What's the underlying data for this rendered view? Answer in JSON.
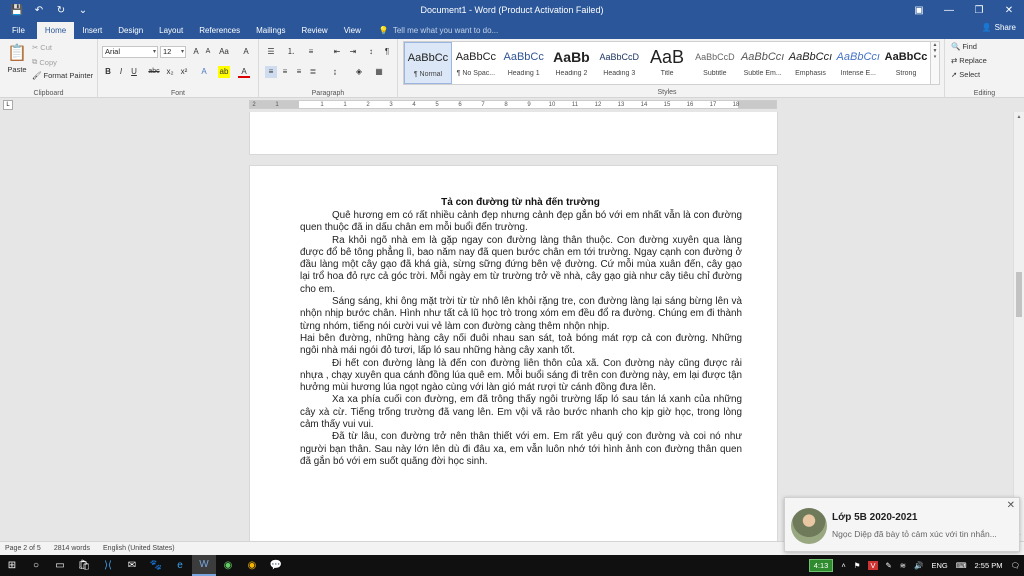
{
  "titlebar": {
    "title": "Document1 - Word (Product Activation Failed)",
    "qat": [
      "💾",
      "↶",
      "↻",
      "⌄"
    ],
    "win": [
      "▣",
      "—",
      "❐",
      "✕"
    ]
  },
  "tabs": [
    "File",
    "Home",
    "Insert",
    "Design",
    "Layout",
    "References",
    "Mailings",
    "Review",
    "View"
  ],
  "tellme": "Tell me what you want to do...",
  "share": "Share",
  "clipboard": {
    "paste": "Paste",
    "cut": "Cut",
    "copy": "Copy",
    "format_painter": "Format Painter",
    "label": "Clipboard"
  },
  "font": {
    "name": "Arial",
    "size": "12",
    "label": "Font"
  },
  "paragraph": {
    "label": "Paragraph"
  },
  "styles": {
    "label": "Styles",
    "items": [
      {
        "sample": "AaBbCc",
        "name": "¶ Normal"
      },
      {
        "sample": "AaBbCc",
        "name": "¶ No Spac..."
      },
      {
        "sample": "AaBbCc",
        "name": "Heading 1"
      },
      {
        "sample": "AaBb",
        "name": "Heading 2"
      },
      {
        "sample": "AaBbCcD",
        "name": "Heading 3"
      },
      {
        "sample": "AaB",
        "name": "Title"
      },
      {
        "sample": "AaBbCcD",
        "name": "Subtitle"
      },
      {
        "sample": "AaBbCcı",
        "name": "Subtle Em..."
      },
      {
        "sample": "AaBbCcı",
        "name": "Emphasis"
      },
      {
        "sample": "AaBbCcı",
        "name": "Intense E..."
      },
      {
        "sample": "AaBbCc",
        "name": "Strong"
      }
    ]
  },
  "editing": {
    "find": "Find",
    "replace": "Replace",
    "select": "Select",
    "label": "Editing"
  },
  "ruler": [
    "2",
    "1",
    "1",
    "1",
    "2",
    "3",
    "4",
    "5",
    "6",
    "7",
    "8",
    "9",
    "10",
    "11",
    "12",
    "13",
    "14",
    "15",
    "16",
    "17",
    "18"
  ],
  "document": {
    "title": "Tả con đường từ nhà đến trường",
    "paragraphs": [
      "Quê hương em có rất nhiều cảnh đẹp nhưng cảnh đẹp gắn bó với em nhất vẫn là con đường quen thuộc đã in dấu chân em mỗi buổi đến trường.",
      "Ra khỏi ngõ nhà em là gặp ngay con đường làng thân thuộc. Con đường xuyên qua làng được đổ bê tông phẳng lì, bao năm nay đã quen bước chân em tới trường. Ngay cạnh con đường ở đầu làng một cây gạo đã khá già, sừng sững đứng bên vệ đường. Cứ mỗi mùa xuân đến, cây gạo lại trổ hoa đỏ rực cả góc trời. Mỗi ngày em từ trường trở về nhà, cây gạo già như cây tiêu chỉ đường cho em.",
      "Sáng sáng, khi ông mặt trời từ từ nhô lên khỏi rặng tre, con đường làng lại sáng bừng lên và nhộn nhịp bước chân. Hình như tất cả lũ học trò trong xóm em đều đổ ra đường. Chúng em đi thành từng nhóm, tiếng nói cười vui vẻ làm con đường càng thêm nhộn nhịp.",
      "Hai bên đường, những hàng cây nối đuôi nhau san sát, toả bóng mát rợp cả con đường. Những ngôi nhà mái ngói đỏ tươi, lấp ló sau những hàng cây xanh tốt.",
      "Đi hết con đường làng là đến con đường liên thôn của xã. Con đường này cũng được rải nhựa , chạy xuyên qua cánh đồng lúa quê em. Mỗi buổi sáng đi trên con đường này, em lại được tận hưởng mùi hương lúa ngọt ngào cùng với làn gió mát rượi từ cánh đồng đưa lên.",
      "Xa xa phía cuối con đường, em đã trông thấy ngôi trường lấp ló sau tán lá xanh của những cây xà cừ. Tiếng trống trường đã vang lên. Em vội vã rảo bước nhanh cho kịp giờ học, trong lòng cảm thấy vui vui.",
      "Đã từ lâu, con đường trở nên thân thiết với em. Em rất yêu quý con đường và coi nó như người bạn thân. Sau này lớn lên dù đi đâu xa, em vẫn luôn nhớ tới hình ảnh con đường thân quen đã gắn bó với em suốt quãng đời học sinh."
    ]
  },
  "status": {
    "page": "Page 2 of 5",
    "words": "2814 words",
    "language": "English (United States)"
  },
  "taskbar": {
    "battery": "4:13",
    "lang": "ENG",
    "time": "2:55 PM"
  },
  "toast": {
    "title": "Lớp 5B 2020-2021",
    "message": "Ngọc Diệp đã bày tỏ cảm xúc với tin nhắn..."
  }
}
